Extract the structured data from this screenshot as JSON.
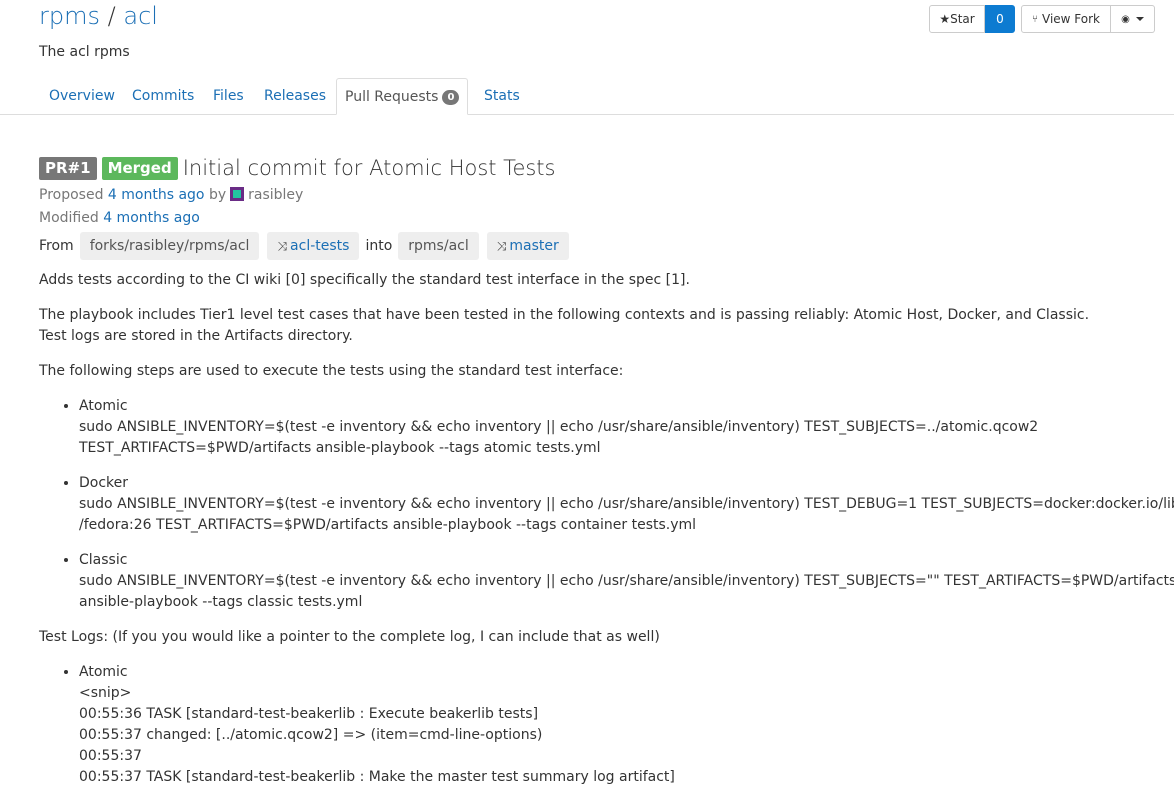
{
  "repo": {
    "namespace": "rpms",
    "separator": "/",
    "name": "acl",
    "description": "The acl rpms"
  },
  "header_buttons": {
    "star_label": "Star",
    "star_count": "0",
    "fork_label": "View Fork"
  },
  "tabs": [
    {
      "label": "Overview"
    },
    {
      "label": "Commits"
    },
    {
      "label": "Files"
    },
    {
      "label": "Releases"
    },
    {
      "label": "Pull Requests",
      "badge": "0",
      "active": true
    },
    {
      "label": "Stats"
    }
  ],
  "pr": {
    "number_label": "PR#1",
    "status": "Merged",
    "title": "Initial commit for Atomic Host Tests",
    "proposed_prefix": "Proposed",
    "proposed_time": "4 months ago",
    "by": "by",
    "author": "rasibley",
    "modified_prefix": "Modified",
    "modified_time": "4 months ago",
    "from_label": "From",
    "source_repo": "forks/rasibley/rpms/acl",
    "source_branch": "acl-tests",
    "into_label": "into",
    "target_repo": "rpms/acl",
    "target_branch": "master"
  },
  "description": {
    "p1": "Adds tests according to the CI wiki [0] specifically the standard test interface in the spec [1].",
    "p2a": "The playbook includes Tier1 level test cases that have been tested in the following contexts and is passing reliably: Atomic Host, Docker, and Classic.",
    "p2b": "Test logs are stored in the Artifacts directory.",
    "p3": "The following steps are used to execute the tests using the standard test interface:",
    "steps": [
      {
        "name": "Atomic",
        "line1": "sudo ANSIBLE_INVENTORY=$(test -e inventory && echo inventory || echo /usr/share/ansible/inventory) TEST_SUBJECTS=../atomic.qcow2",
        "line2": "TEST_ARTIFACTS=$PWD/artifacts ansible-playbook --tags atomic tests.yml"
      },
      {
        "name": "Docker",
        "line1": "sudo ANSIBLE_INVENTORY=$(test -e inventory && echo inventory || echo /usr/share/ansible/inventory) TEST_DEBUG=1 TEST_SUBJECTS=docker:docker.io/library",
        "line2": "/fedora:26 TEST_ARTIFACTS=$PWD/artifacts ansible-playbook --tags container tests.yml"
      },
      {
        "name": "Classic",
        "line1": "sudo ANSIBLE_INVENTORY=$(test -e inventory && echo inventory || echo /usr/share/ansible/inventory) TEST_SUBJECTS=\"\" TEST_ARTIFACTS=$PWD/artifacts",
        "line2": "ansible-playbook --tags classic tests.yml"
      }
    ],
    "p4": "Test Logs: (If you you would like a pointer to the complete log, I can include that as well)",
    "logs": {
      "name": "Atomic",
      "lines": [
        "<snip>",
        "00:55:36 TASK [standard-test-beakerlib : Execute beakerlib tests]",
        "00:55:37 changed: [../atomic.qcow2] => (item=cmd-line-options)",
        "00:55:37",
        "00:55:37 TASK [standard-test-beakerlib : Make the master test summary log artifact]"
      ]
    }
  }
}
